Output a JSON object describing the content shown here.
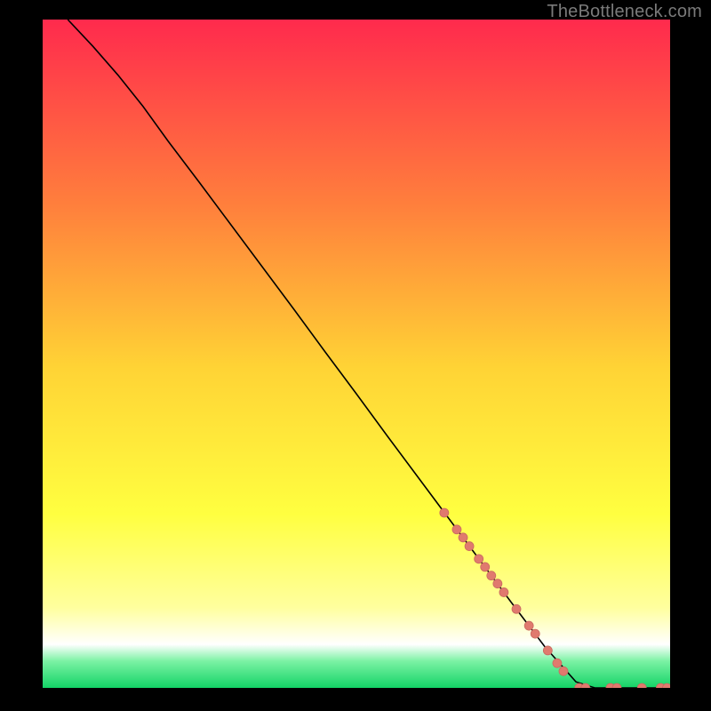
{
  "watermark": "TheBottleneck.com",
  "colors": {
    "bg": "#000000",
    "curve": "#000000",
    "dot_fill": "#e07a6e",
    "dot_stroke": "#c96a60",
    "grad_top": "#ff2a4d",
    "grad_mid_upper": "#ff803c",
    "grad_mid": "#ffd335",
    "grad_mid_lower": "#ffff40",
    "grad_pale_yellow": "#ffff9e",
    "grad_white": "#ffffff",
    "grad_mint": "#7bf2a4",
    "grad_green": "#13d366"
  },
  "chart_data": {
    "type": "line",
    "xlim": [
      0,
      100
    ],
    "ylim": [
      0,
      100
    ],
    "curve": [
      {
        "x": 4.0,
        "y": 100.0
      },
      {
        "x": 8.0,
        "y": 96.0
      },
      {
        "x": 12.0,
        "y": 91.7
      },
      {
        "x": 16.0,
        "y": 87.0
      },
      {
        "x": 20.0,
        "y": 81.8
      },
      {
        "x": 25.0,
        "y": 75.6
      },
      {
        "x": 30.0,
        "y": 69.3
      },
      {
        "x": 35.0,
        "y": 63.0
      },
      {
        "x": 40.0,
        "y": 56.7
      },
      {
        "x": 45.0,
        "y": 50.3
      },
      {
        "x": 50.0,
        "y": 44.0
      },
      {
        "x": 55.0,
        "y": 37.6
      },
      {
        "x": 60.0,
        "y": 31.3
      },
      {
        "x": 65.0,
        "y": 25.0
      },
      {
        "x": 70.0,
        "y": 18.7
      },
      {
        "x": 75.0,
        "y": 12.4
      },
      {
        "x": 80.0,
        "y": 6.2
      },
      {
        "x": 85.0,
        "y": 0.9
      },
      {
        "x": 88.0,
        "y": 0.0
      },
      {
        "x": 100.0,
        "y": 0.0
      }
    ],
    "markers": [
      {
        "x": 64.0,
        "y": 26.2,
        "r": 5.0
      },
      {
        "x": 66.0,
        "y": 23.7,
        "r": 5.0
      },
      {
        "x": 67.0,
        "y": 22.5,
        "r": 5.0
      },
      {
        "x": 68.0,
        "y": 21.2,
        "r": 5.0
      },
      {
        "x": 69.5,
        "y": 19.3,
        "r": 5.0
      },
      {
        "x": 70.5,
        "y": 18.1,
        "r": 5.0
      },
      {
        "x": 71.5,
        "y": 16.8,
        "r": 5.0
      },
      {
        "x": 72.5,
        "y": 15.6,
        "r": 5.0
      },
      {
        "x": 73.5,
        "y": 14.3,
        "r": 5.0
      },
      {
        "x": 75.5,
        "y": 11.8,
        "r": 5.0
      },
      {
        "x": 77.5,
        "y": 9.3,
        "r": 5.0
      },
      {
        "x": 78.5,
        "y": 8.1,
        "r": 5.0
      },
      {
        "x": 80.5,
        "y": 5.6,
        "r": 5.0
      },
      {
        "x": 82.0,
        "y": 3.7,
        "r": 5.0
      },
      {
        "x": 83.0,
        "y": 2.5,
        "r": 5.0
      },
      {
        "x": 85.5,
        "y": 0.0,
        "r": 5.0
      },
      {
        "x": 86.5,
        "y": 0.0,
        "r": 5.0
      },
      {
        "x": 90.5,
        "y": 0.0,
        "r": 5.0
      },
      {
        "x": 91.5,
        "y": 0.0,
        "r": 5.0
      },
      {
        "x": 95.5,
        "y": 0.0,
        "r": 5.0
      },
      {
        "x": 98.5,
        "y": 0.0,
        "r": 5.0
      },
      {
        "x": 99.5,
        "y": 0.0,
        "r": 5.0
      }
    ]
  }
}
